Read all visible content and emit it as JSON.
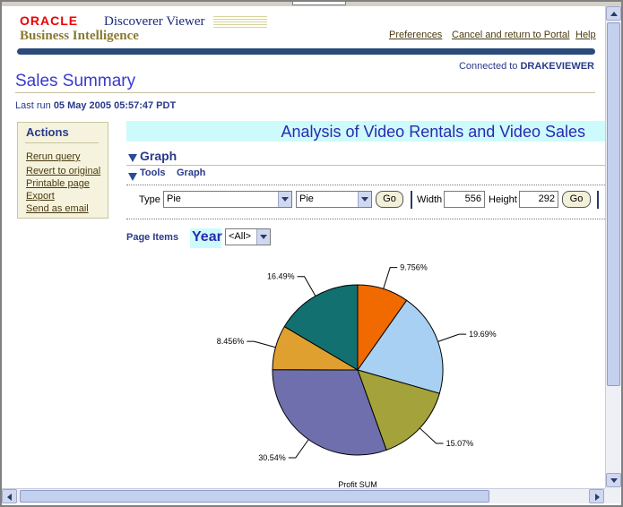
{
  "header": {
    "oracle": "ORACLE",
    "product": "Discoverer Viewer",
    "subtitle": "Business Intelligence",
    "nav": [
      "Preferences",
      "Cancel and return to Portal",
      "Help"
    ]
  },
  "connection": {
    "label": "Connected to",
    "user": "DRAKEVIEWER"
  },
  "page_title": "Sales Summary",
  "last_run": {
    "label": "Last run",
    "value": "05 May 2005 05:57:47 PDT"
  },
  "actions": {
    "title": "Actions",
    "items": [
      "Rerun query",
      "Revert to original",
      "Printable page",
      "Export",
      "Send as email"
    ]
  },
  "analysis_title": "Analysis of Video Rentals and Video Sales",
  "graph_section": {
    "title": "Graph",
    "tools_label": "Tools",
    "tools_graph": "Graph"
  },
  "toolbar": {
    "type_label": "Type",
    "type_value": "Pie",
    "subtype_value": "Pie",
    "go_label": "Go",
    "width_label": "Width",
    "width_value": "556",
    "height_label": "Height",
    "height_value": "292",
    "go2_label": "Go"
  },
  "page_items": {
    "label": "Page Items",
    "year_label": "Year",
    "year_value": "<All>"
  },
  "chart_data": {
    "type": "pie",
    "title": "",
    "xlabel": "Profit SUM",
    "values": [
      9.756,
      19.69,
      15.07,
      30.54,
      8.456,
      16.49
    ],
    "labels": [
      "9.756%",
      "19.69%",
      "15.07%",
      "30.54%",
      "8.456%",
      "16.49%"
    ],
    "colors": [
      "#f06a00",
      "#a8d0f2",
      "#a4a23a",
      "#6f6fae",
      "#e0a030",
      "#127070"
    ],
    "start_angle_deg": 0,
    "direction": "clockwise"
  }
}
